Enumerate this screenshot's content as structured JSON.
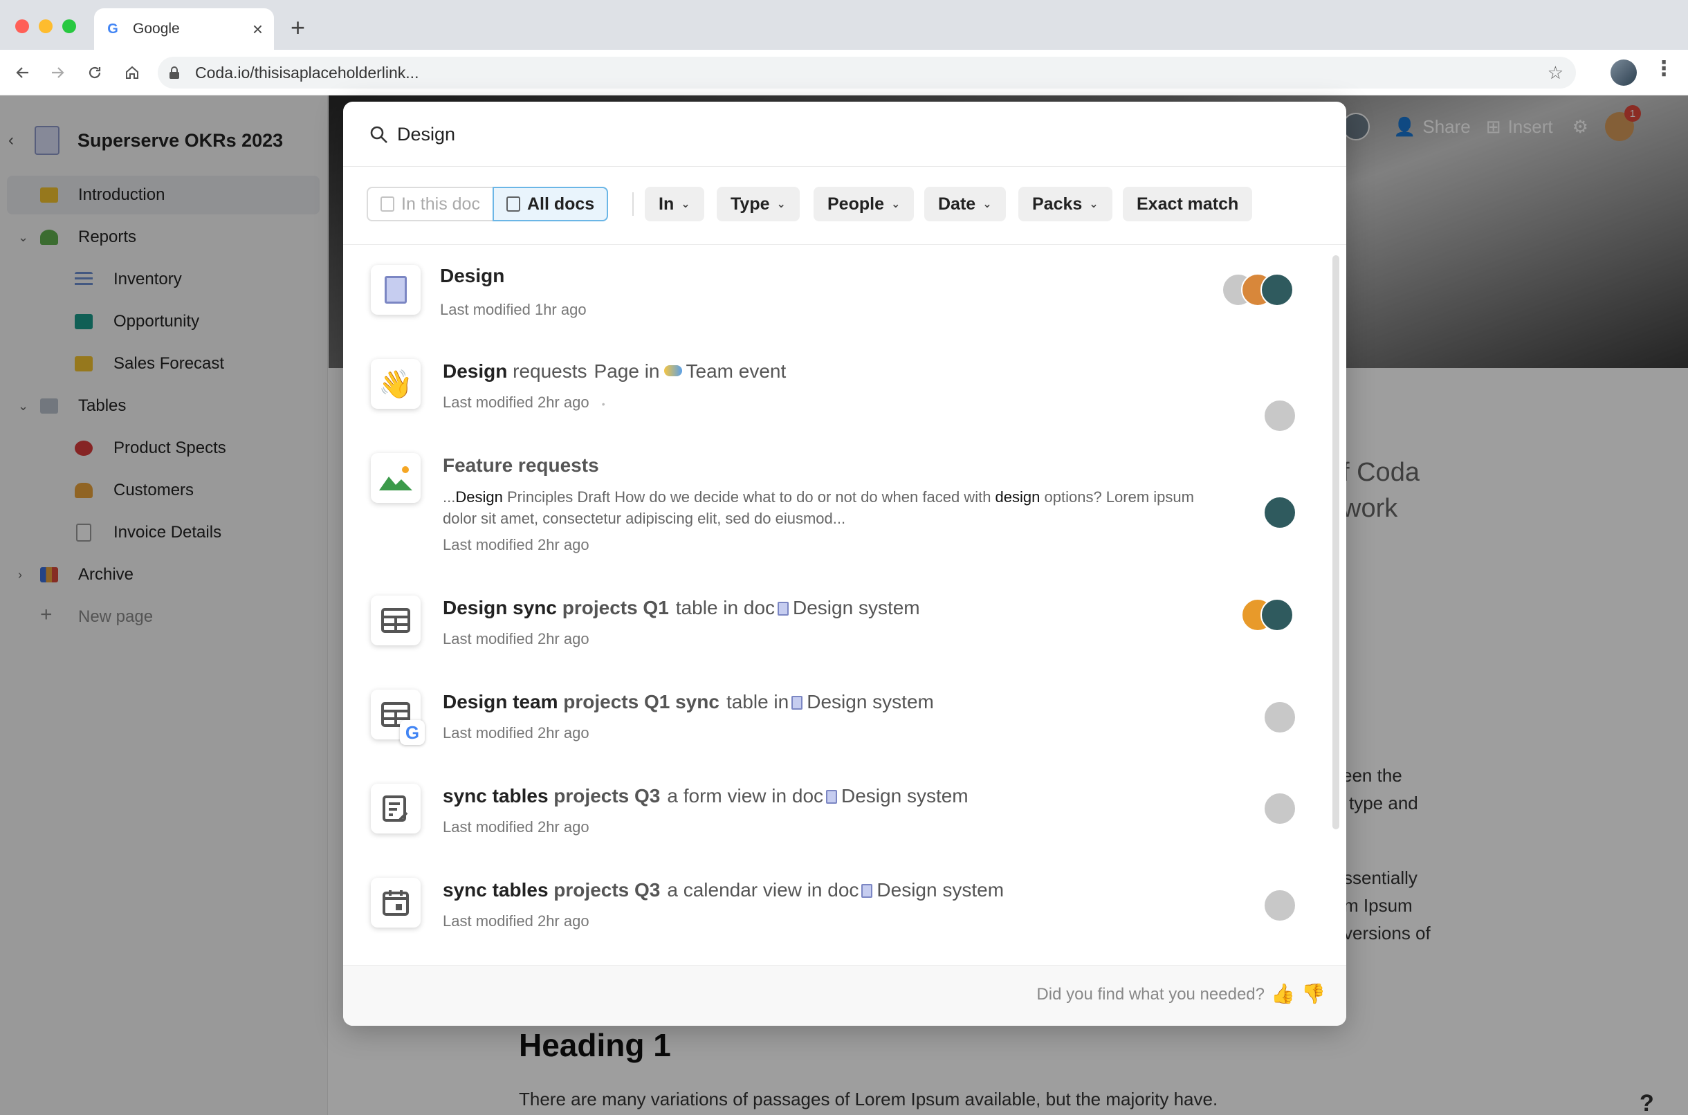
{
  "browser": {
    "tab_title": "Google",
    "url": "Coda.io/thisisaplaceholderlink..."
  },
  "doc": {
    "name": "Superserve OKRs 2023"
  },
  "sidebar": {
    "items": [
      {
        "label": "Introduction"
      },
      {
        "label": "Reports"
      },
      {
        "label": "Inventory"
      },
      {
        "label": "Opportunity"
      },
      {
        "label": "Sales Forecast"
      },
      {
        "label": "Tables"
      },
      {
        "label": "Product Spects"
      },
      {
        "label": "Customers"
      },
      {
        "label": "Invoice Details"
      },
      {
        "label": "Archive"
      },
      {
        "label": "New page"
      }
    ]
  },
  "topbar": {
    "share_label": "Share",
    "insert_label": "Insert",
    "notification_count": "1"
  },
  "background_text": {
    "fragment_1": "f Coda",
    "fragment_2": "work",
    "fragment_3": "een the",
    "fragment_4": "type and",
    "fragment_5": "ssentially",
    "fragment_6": "m Ipsum",
    "fragment_7": "versions of",
    "heading": "Heading 1",
    "paragraph": "There are many variations of passages of Lorem Ipsum available, but the majority have.",
    "help": "?"
  },
  "search": {
    "query": "Design",
    "scope_left": "In this doc",
    "scope_right": "All docs",
    "filters": [
      "In",
      "Type",
      "People",
      "Date",
      "Packs"
    ],
    "exact_match": "Exact match"
  },
  "results": [
    {
      "title_bold": "Design",
      "title_rest": "",
      "context": "",
      "meta": "Last modified 1hr ago"
    },
    {
      "title_bold": "Design",
      "title_rest": " requests",
      "context_pre": "Page in",
      "context_doc": "Team event",
      "meta": "Last modified 2hr ago",
      "meta_dot": "•"
    },
    {
      "title": "Feature requests",
      "snippet_pre": "...",
      "snippet_hit1": "Design",
      "snippet_mid": " Principles Draft How do we decide what to do or not do when faced with ",
      "snippet_hit2": "design",
      "snippet_post": " options? Lorem ipsum dolor sit amet, consectetur adipiscing elit, sed do eiusmod...",
      "meta": "Last modified 2hr ago"
    },
    {
      "title_bold": "Design sync",
      "title_rest": " projects Q1",
      "context_pre": "table in doc",
      "context_doc": "Design system",
      "meta": "Last modified 2hr ago"
    },
    {
      "title_bold": "Design team",
      "title_rest": " projects Q1 sync",
      "context_pre": "table in",
      "context_doc": "Design system",
      "meta": "Last modified 2hr ago"
    },
    {
      "title_bold": "sync tables",
      "title_rest": " projects Q3",
      "context_pre": "a form view in doc",
      "context_doc": "Design system",
      "meta": "Last modified 2hr ago"
    },
    {
      "title_bold": "sync tables",
      "title_rest": " projects Q3",
      "context_pre": "a calendar view in doc",
      "context_doc": "Design system",
      "meta": "Last modified 2hr ago"
    }
  ],
  "footer": {
    "question": "Did you find what you needed?"
  },
  "colors": {
    "accent": "#6bb6e6",
    "scrim": "#000000"
  }
}
